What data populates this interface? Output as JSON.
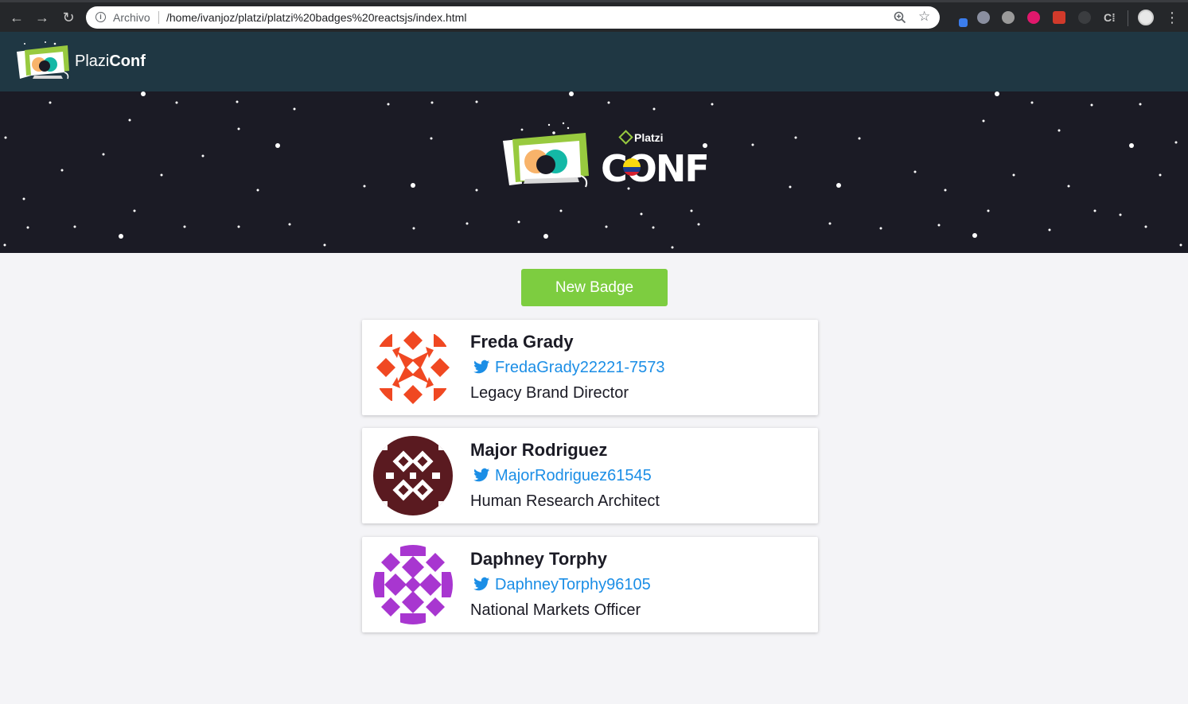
{
  "browser": {
    "omnibox_label": "Archivo",
    "url": "/home/ivanjoz/platzi/platzi%20badges%20reactsjs/index.html",
    "extension_icons": [
      "extension-color-icon",
      "extension-spy-icon",
      "extension-grey-icon",
      "extension-pink-icon",
      "extension-red-icon",
      "extension-dark-icon",
      "extension-c-icon"
    ],
    "ext_c_glyph": "C⁞"
  },
  "navbar": {
    "brand_light": "Plazi",
    "brand_bold": "Conf"
  },
  "hero": {
    "platzi_label": "Platzi",
    "conf_label": "CONF"
  },
  "main": {
    "new_badge_label": "New Badge"
  },
  "badges": [
    {
      "name": "Freda Grady",
      "twitter": "FredaGrady22221-7573",
      "job": "Legacy Brand Director",
      "avatar_color": "#f04822"
    },
    {
      "name": "Major Rodriguez",
      "twitter": "MajorRodriguez61545",
      "job": "Human Research Architect",
      "avatar_color": "#5a1a20"
    },
    {
      "name": "Daphney Torphy",
      "twitter": "DaphneyTorphy96105",
      "job": "National Markets Officer",
      "avatar_color": "#a836d0"
    }
  ],
  "colors": {
    "navbar_bg": "#1f3743",
    "hero_bg": "#1b1b25",
    "button_green": "#7dcd40",
    "twitter_blue": "#1b8ee6",
    "page_bg": "#f4f4f7"
  }
}
